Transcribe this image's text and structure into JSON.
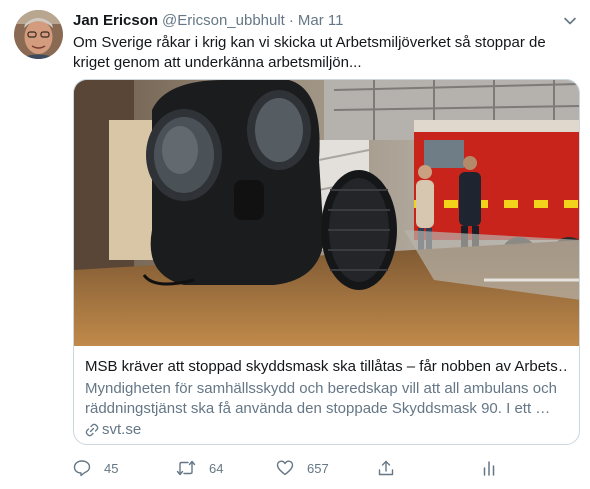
{
  "tweet": {
    "author_name": "Jan Ericson",
    "author_handle": "@Ericson_ubbhult",
    "separator": "·",
    "date": "Mar 11",
    "text_line1": "Om Sverige råkar i krig kan vi skicka ut Arbetsmiljöverket så stoppar de",
    "text_line2": "kriget genom att underkänna arbetsmiljön..."
  },
  "card": {
    "title": "MSB kräver att stoppad skyddsmask ska tillåtas – får nobben av Arbets…",
    "description": "Myndigheten för samhällsskydd och beredskap vill att all ambulans och räddningstjänst ska få använda den stoppade Skyddsmask 90. I ett …",
    "domain": "svt.se"
  },
  "actions": {
    "replies": "45",
    "retweets": "64",
    "likes": "657"
  },
  "icons": {
    "caret": "chevron-down-icon",
    "reply": "reply-icon",
    "retweet": "retweet-icon",
    "like": "heart-icon",
    "share": "share-icon",
    "analytics": "analytics-icon",
    "link": "link-icon"
  },
  "colors": {
    "text_primary": "#14171a",
    "text_secondary": "#657786",
    "border": "#ccd6dd"
  }
}
